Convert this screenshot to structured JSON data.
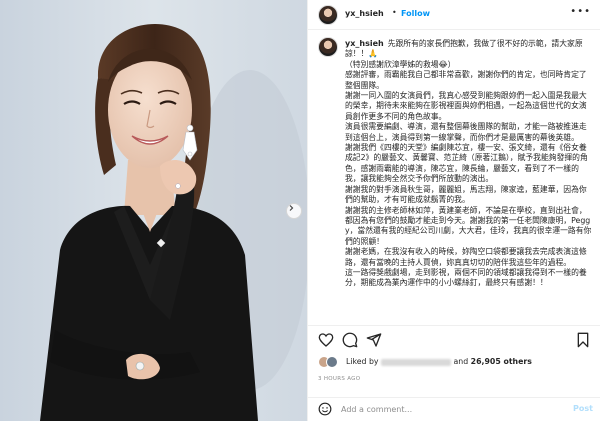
{
  "post": {
    "username": "yx_hsieh",
    "dot": "•",
    "follow_label": "Follow",
    "more_label": "•••",
    "caption_text": "先跟所有的家長們抱歉，我做了很不好的示範，請大家原諒！！🙏\n（特別感謝欣漳學姊的救場😂）\n感謝評審，雨霸能我自己都非常喜歡，謝謝你們的肯定，也同時肯定了整個團隊。\n謝謝一同入圍的女演員們，我真心感受到能夠跟妳們一起入圍是我最大的榮幸，期待未來能夠在影視裡面與妳們相遇，一起為這個世代的女演員創作更多不同的角色故事。\n演員很需要編劇、導演，還有整個幕後團隊的幫助，才能一路被推進走到這個台上，演員得到第一線掌聲，而你們才是最厲害的幕後英雄。\n謝謝我們《四樓的天堂》編劇陳芯宜，樓一安、張文綺，還有《俗女養成記2》的嚴藝文、黃馨寶、范芷綺（原著江鵝），賦予我能夠發揮的角色，感謝雨霸能的導演，陳芯宜，陳長綸，嚴藝文，看到了不一樣的我，讓我能夠全然交予你們所放動的演出。\n謝謝我的對手演員秋生哥，麗麗姐，馬志翔，陳家逵，藍建華，因為你們的幫助，才有可能成就鬍菁的我。\n謝謝我的主修老師林如萍，黃建業老師，不論是在學校，直到出社會，都因為有您們的鼓勵才能走到今天。謝謝我的第一任老闆陳康明，Peggy，當然還有我的經紀公司川劇，大大君，佳玲，我真的很幸運一路有你們的照顧！\n謝謝老媽，在我沒有收入的時候，妳陶空口袋都要讓我去完成表演這條路，還有當晚的主持人賈偵，妳真真切切的陪伴我這些年的過程。\n這一路得獎戲劇場，走到影視，兩個不同的領域都讓我得到不一樣的養分，期能成為業內運作中的小小螺絲釘，最終只有感謝！！",
    "likes_prefix": "Liked by",
    "likes_mid": "and",
    "likes_count": "26,905 others",
    "timestamp": "3 HOURS AGO",
    "comment_placeholder": "Add a comment...",
    "post_label": "Post"
  },
  "icons": {
    "heart": "heart-icon",
    "comment": "comment-icon",
    "share": "share-icon",
    "save": "bookmark-icon",
    "emoji": "emoji-icon",
    "next": "chevron-right-icon"
  },
  "colors": {
    "accent": "#0095f6",
    "post_disabled": "#b2dffc",
    "muted": "#8e8e8e",
    "text": "#262626"
  }
}
